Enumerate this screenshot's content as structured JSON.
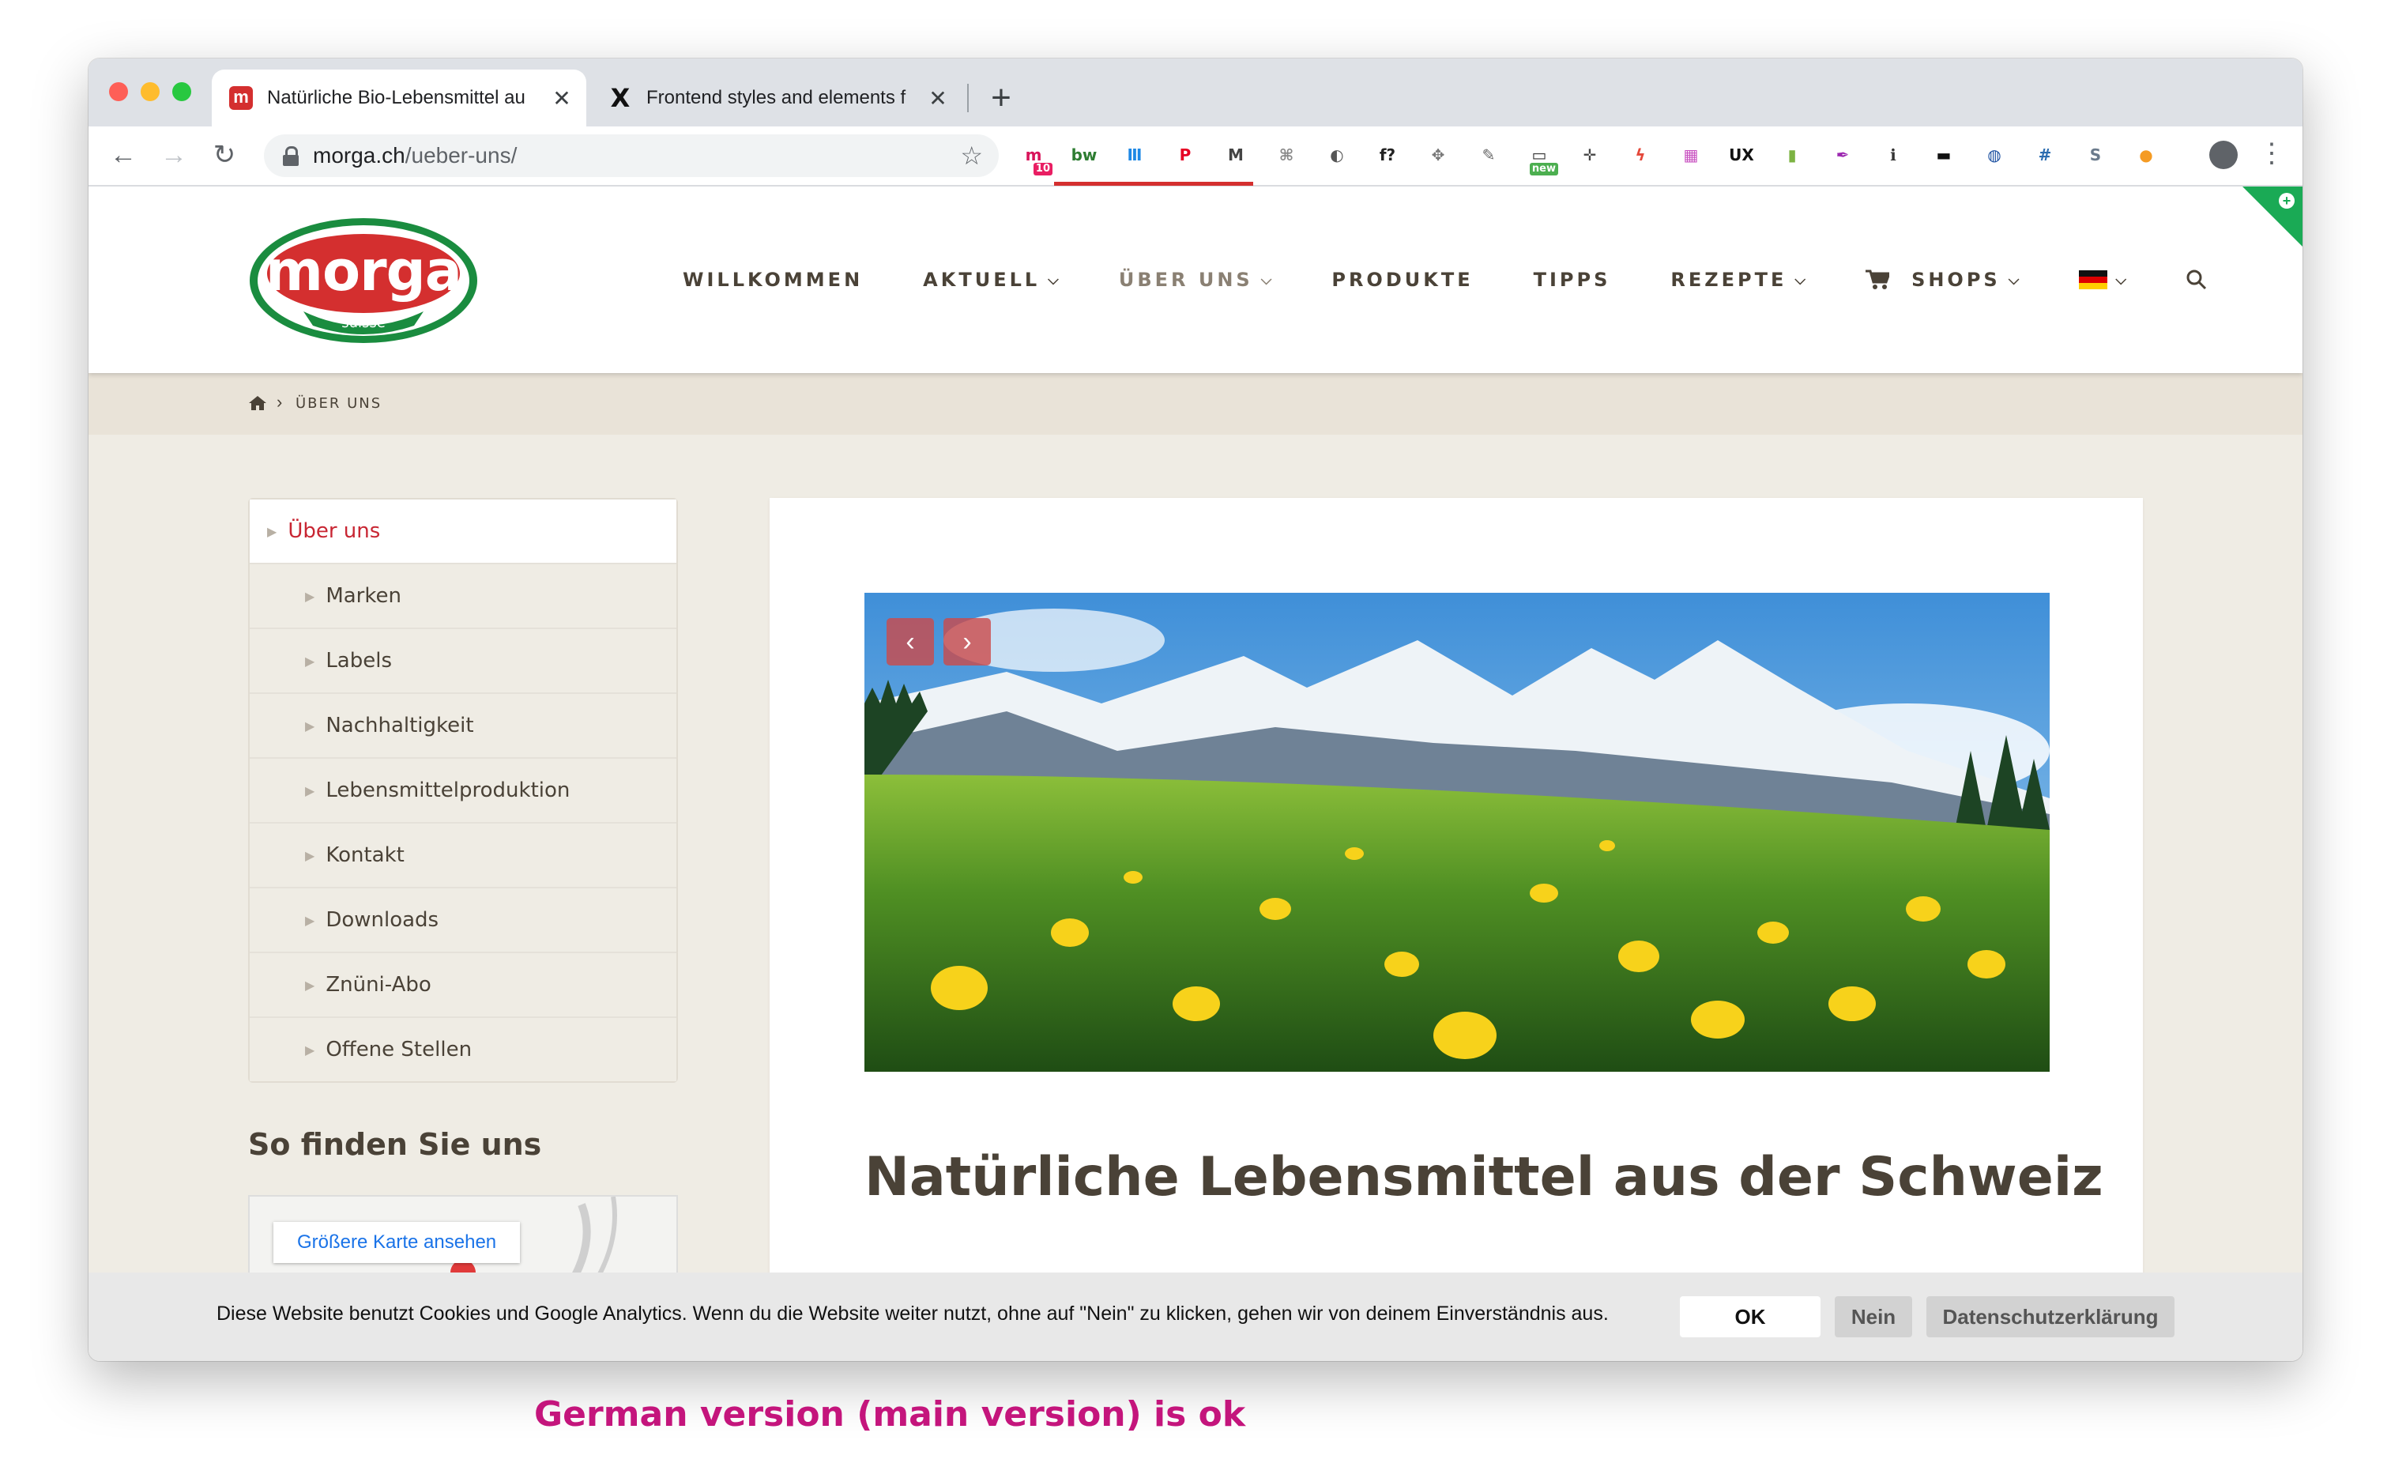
{
  "browser": {
    "tabs": [
      {
        "title": "Natürliche Bio-Lebensmittel au",
        "close": "✕",
        "favicon": "m"
      },
      {
        "title": "Frontend styles and elements f",
        "close": "✕",
        "favicon": "X"
      }
    ],
    "new_tab": "+",
    "url_host": "morga.ch",
    "url_path": "/ueber-uns/",
    "extensions": [
      {
        "icon": "mailtrack-icon",
        "label": "m",
        "badge": "10",
        "color": "#d8145a"
      },
      {
        "icon": "bw-icon",
        "label": "bw",
        "color": "#2e7d32"
      },
      {
        "icon": "calendar-icon",
        "label": "Ⅲ",
        "color": "#1e88e5"
      },
      {
        "icon": "pinterest-icon",
        "label": "P",
        "color": "#e60023"
      },
      {
        "icon": "gmail-icon",
        "label": "M",
        "color": "#444444"
      },
      {
        "icon": "link-icon",
        "label": "⌘",
        "color": "#888888"
      },
      {
        "icon": "moon-icon",
        "label": "◐",
        "color": "#555555"
      },
      {
        "icon": "font-icon",
        "label": "f?",
        "color": "#222222"
      },
      {
        "icon": "dropbox-icon",
        "label": "✥",
        "color": "#777777"
      },
      {
        "icon": "eyedropper-icon",
        "label": "✎",
        "color": "#666666"
      },
      {
        "icon": "screenshot-icon",
        "label": "▭",
        "badge": "new",
        "color": "#333333"
      },
      {
        "icon": "move-icon",
        "label": "✛",
        "color": "#444444"
      },
      {
        "icon": "bolt-icon",
        "label": "ϟ",
        "color": "#e4483a"
      },
      {
        "icon": "gradient-icon",
        "label": "▦",
        "color": "#c850c0"
      },
      {
        "icon": "ux-icon",
        "label": "UX",
        "color": "#111111"
      },
      {
        "icon": "bookmark-icon",
        "label": "▮",
        "color": "#7cb342"
      },
      {
        "icon": "pen-icon",
        "label": "✒",
        "color": "#9c27b0"
      },
      {
        "icon": "info-icon",
        "label": "ℹ",
        "color": "#333333"
      },
      {
        "icon": "flag-icon",
        "label": "▬",
        "color": "#111111"
      },
      {
        "icon": "stack-icon",
        "label": "◍",
        "color": "#1a4fa0"
      },
      {
        "icon": "grid-icon",
        "label": "#",
        "color": "#2b6cb0"
      },
      {
        "icon": "s-icon",
        "label": "S",
        "color": "#6b7b8c"
      },
      {
        "icon": "orange-icon",
        "label": "●",
        "color": "#f59b23"
      }
    ],
    "profile": "●",
    "menu": "⋮"
  },
  "site": {
    "logo_text": "morga",
    "logo_sub": "suisse",
    "nav": [
      {
        "label": "WILLKOMMEN"
      },
      {
        "label": "AKTUELL",
        "caret": "⌵"
      },
      {
        "label": "ÜBER UNS",
        "caret": "⌵"
      },
      {
        "label": "PRODUKTE"
      },
      {
        "label": "TIPPS"
      },
      {
        "label": "REZEPTE",
        "caret": "⌵"
      },
      {
        "label": "SHOPS",
        "caret": "⌵"
      },
      {
        "label": "",
        "caret": "⌵"
      }
    ],
    "breadcrumb": "ÜBER UNS",
    "sidebar": [
      "Über uns",
      "Marken",
      "Labels",
      "Nachhaltigkeit",
      "Lebensmittelproduktion",
      "Kontakt",
      "Downloads",
      "Znüni-Abo",
      "Offene Stellen"
    ],
    "map_heading": "So finden Sie uns",
    "map_link": "Größere Karte ansehen",
    "headline": "Natürliche Lebensmittel aus der Schweiz",
    "slider_prev": "‹",
    "slider_next": "›"
  },
  "cookie": {
    "text": "Diese Website benutzt Cookies und Google Analytics. Wenn du die Website weiter nutzt, ohne auf \"Nein\" zu klicken, gehen wir von deinem Einverständnis aus.",
    "ok": "OK",
    "no": "Nein",
    "privacy": "Datenschutzerklärung"
  },
  "caption": "German version (main version) is ok",
  "colors": {
    "brand_red": "#d42f2f",
    "brand_green": "#1a8c3f",
    "caption": "#c4157c",
    "nav_text": "#4a4237",
    "active_nav": "#8a8073"
  }
}
